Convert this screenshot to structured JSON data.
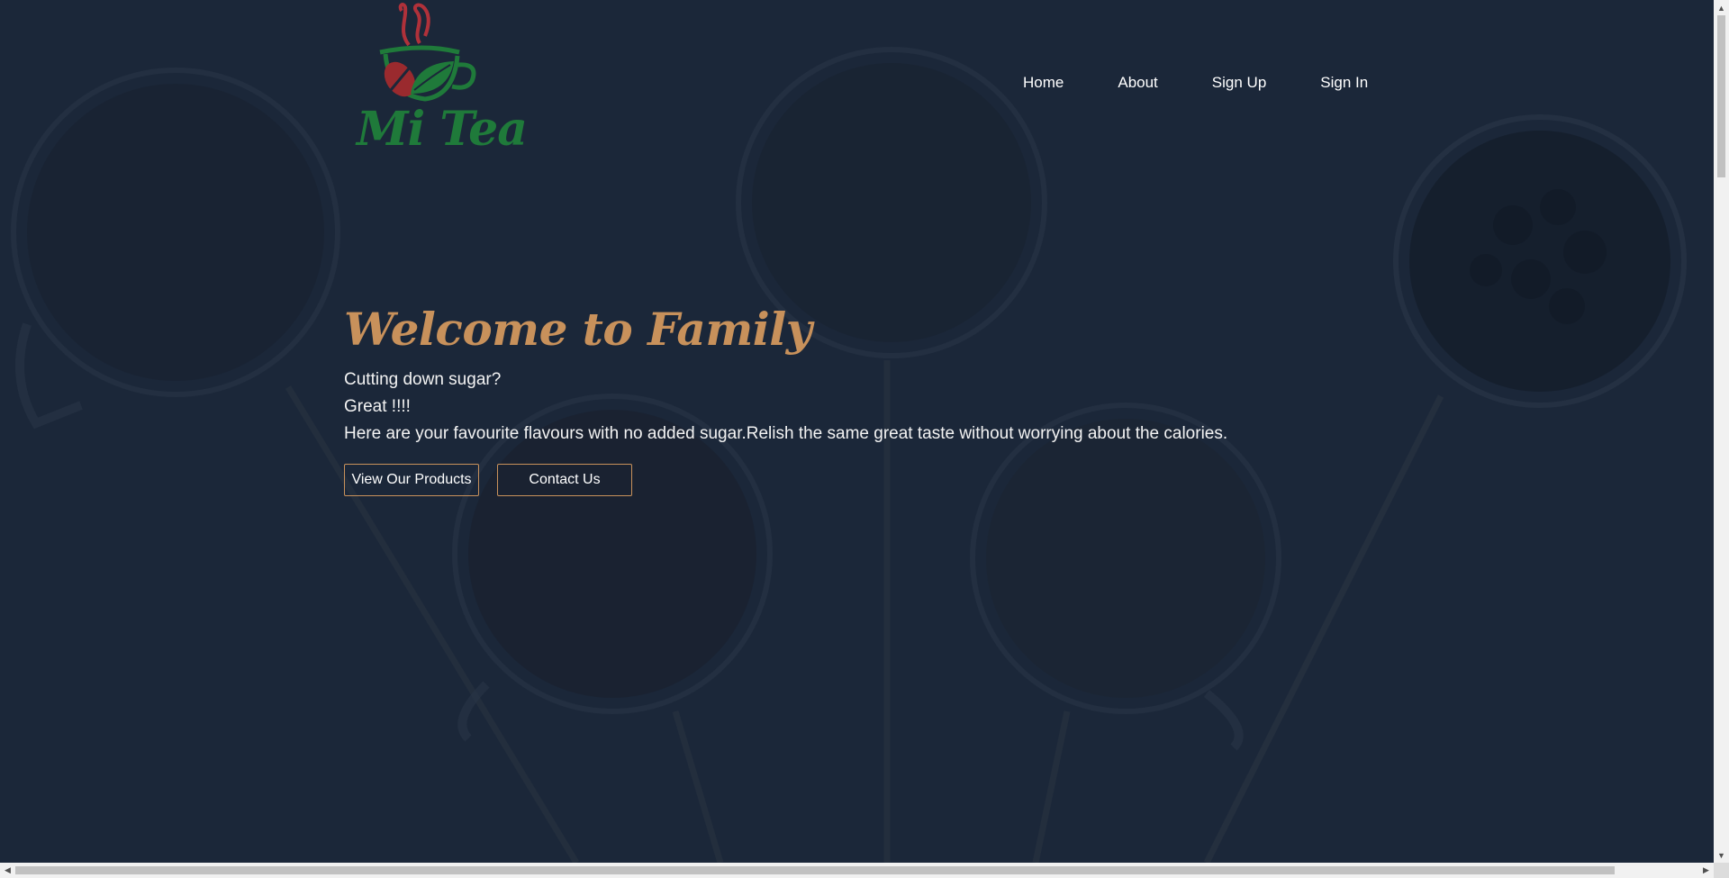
{
  "brand": {
    "logo_text": "Mi Tea",
    "colors": {
      "leaf_green": "#1f7a3a",
      "bean_red": "#9a2a2e",
      "steam_red": "#b0313a"
    }
  },
  "nav": {
    "items": [
      {
        "label": "Home"
      },
      {
        "label": "About"
      },
      {
        "label": "Sign Up"
      },
      {
        "label": "Sign In"
      }
    ]
  },
  "hero": {
    "title": "Welcome to Family",
    "lines": [
      "Cutting down sugar?",
      "Great !!!!",
      "Here are your favourite flavours with no added sugar.Relish the same great taste without worrying about the calories."
    ],
    "buttons": {
      "products_label": "View Our Products",
      "contact_label": "Contact Us"
    }
  },
  "theme": {
    "background": "#1b2739",
    "accent": "#c8915b",
    "text": "#ffffff"
  },
  "scrollbars": {
    "up_icon": "chevron-up-icon",
    "down_icon": "chevron-down-icon",
    "left_icon": "chevron-left-icon",
    "right_icon": "chevron-right-icon"
  }
}
